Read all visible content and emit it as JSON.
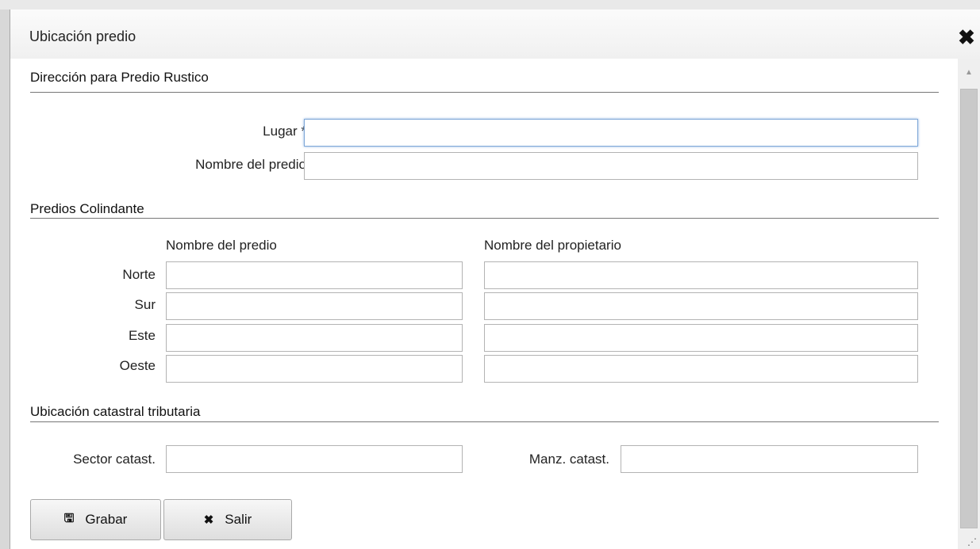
{
  "dialog": {
    "title": "Ubicación predio",
    "close_icon": "close-icon"
  },
  "direccion": {
    "section_title": "Dirección para Predio Rustico",
    "lugar_label": "Lugar *",
    "lugar_value": "",
    "nombre_label": "Nombre del predio",
    "nombre_value": ""
  },
  "colindantes": {
    "section_title": "Predios Colindante",
    "col_predio": "Nombre del predio",
    "col_propietario": "Nombre del propietario",
    "rows": [
      {
        "label": "Norte",
        "predio": "",
        "propietario": ""
      },
      {
        "label": "Sur",
        "predio": "",
        "propietario": ""
      },
      {
        "label": "Este",
        "predio": "",
        "propietario": ""
      },
      {
        "label": "Oeste",
        "predio": "",
        "propietario": ""
      }
    ]
  },
  "catastral": {
    "section_title": "Ubicación catastral tributaria",
    "sector_label": "Sector catast.",
    "sector_value": "",
    "manz_label": "Manz. catast.",
    "manz_value": ""
  },
  "buttons": {
    "save_label": "Grabar",
    "save_icon": "save-icon",
    "exit_label": "Salir",
    "exit_icon": "close-icon"
  }
}
